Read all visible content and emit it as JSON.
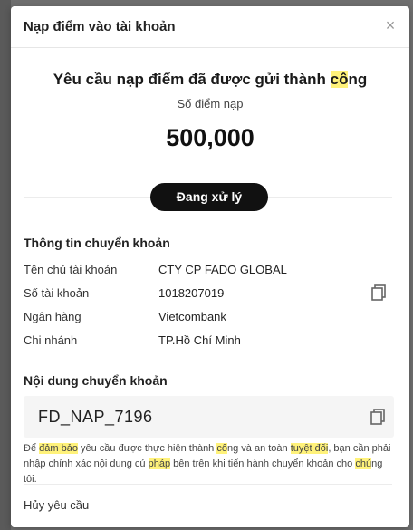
{
  "modal": {
    "title": "Nạp điểm vào tài khoản",
    "close_symbol": "×",
    "success_title": {
      "part1": "Yêu cầu nạp điểm đã được gửi thành ",
      "highlight": "cô",
      "part2": "ng"
    },
    "amount_label": "Số điểm nạp",
    "amount_value": "500,000",
    "status_label": "Đang xử lý"
  },
  "transfer_info": {
    "title": "Thông tin chuyển khoản",
    "rows": [
      {
        "label": "Tên chủ tài khoản",
        "value": "CTY CP FADO GLOBAL"
      },
      {
        "label": "Số tài khoản",
        "value": "1018207019"
      },
      {
        "label": "Ngân hàng",
        "value": "Vietcombank"
      },
      {
        "label": "Chi nhánh",
        "value": "TP.Hồ Chí Minh"
      }
    ]
  },
  "transfer_content": {
    "title": "Nội dung chuyển khoản",
    "code": "FD_NAP_7196",
    "note": {
      "t1": "Để ",
      "h1": "đảm bảo",
      "t2": " yêu cầu được thực hiện thành ",
      "h2": "cô",
      "t3": "ng và an toàn ",
      "h3": "tuyệt đối",
      "t4": ", bạn cần phải nhập chính xác nội dung cú ",
      "h4": "pháp",
      "t5": " bên trên khi tiến hành chuyển khoản cho ",
      "h5": "chú",
      "t6": "ng tôi."
    }
  },
  "cancel_label": "Hủy yêu cầu",
  "colors": {
    "highlight": "#fff27a",
    "pill": "#111111",
    "backdrop": "#6f6f6f"
  },
  "icons": {
    "close": "close-icon",
    "copy": "copy-icon"
  }
}
